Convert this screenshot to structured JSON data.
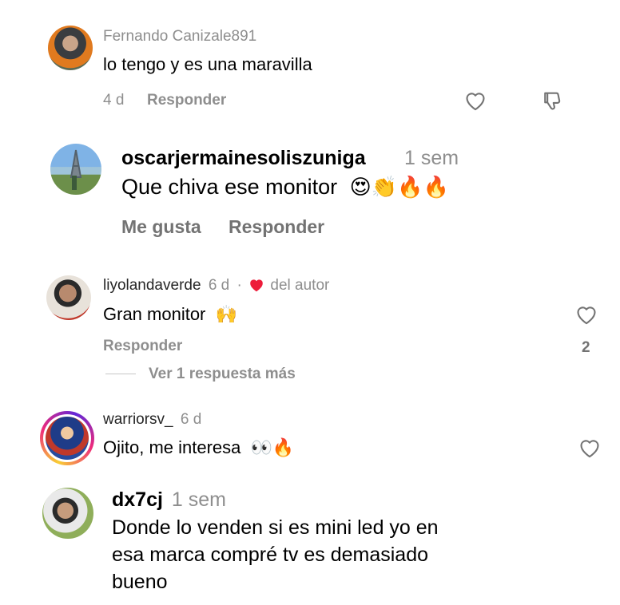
{
  "comments": [
    {
      "username": "Fernando Canizale891",
      "text": "lo tengo y es una maravilla",
      "time": "4 d",
      "reply_label": "Responder"
    },
    {
      "username": "oscarjermainesoliszuniga",
      "time": "1 sem",
      "text": "Que chiva ese monitor",
      "emojis": "😍👏🔥🔥",
      "like_label": "Me gusta",
      "reply_label": "Responder"
    },
    {
      "username": "liyolandaverde",
      "time": "6 d",
      "separator": "·",
      "author_badge": "del autor",
      "text": "Gran monitor",
      "emojis": "🙌",
      "reply_label": "Responder",
      "like_count": "2",
      "view_replies": "Ver 1 respuesta más"
    },
    {
      "username": "warriorsv_",
      "time": "6 d",
      "text": "Ojito, me interesa",
      "emojis": "👀🔥"
    },
    {
      "username": "dx7cj",
      "time": "1 sem",
      "text_lines": [
        "Donde lo venden si es mini led yo en",
        "esa marca compré tv es demasiado",
        "bueno"
      ]
    }
  ],
  "icons": {
    "heart": "heart-icon",
    "dislike": "thumbs-down-icon",
    "author_heart": "red-heart-icon"
  },
  "colors": {
    "muted_text": "#8e8e8e",
    "red": "#ed1c3a",
    "ring_start": "#f9ce34",
    "ring_mid": "#ee2a7b",
    "ring_end": "#6228d7"
  }
}
